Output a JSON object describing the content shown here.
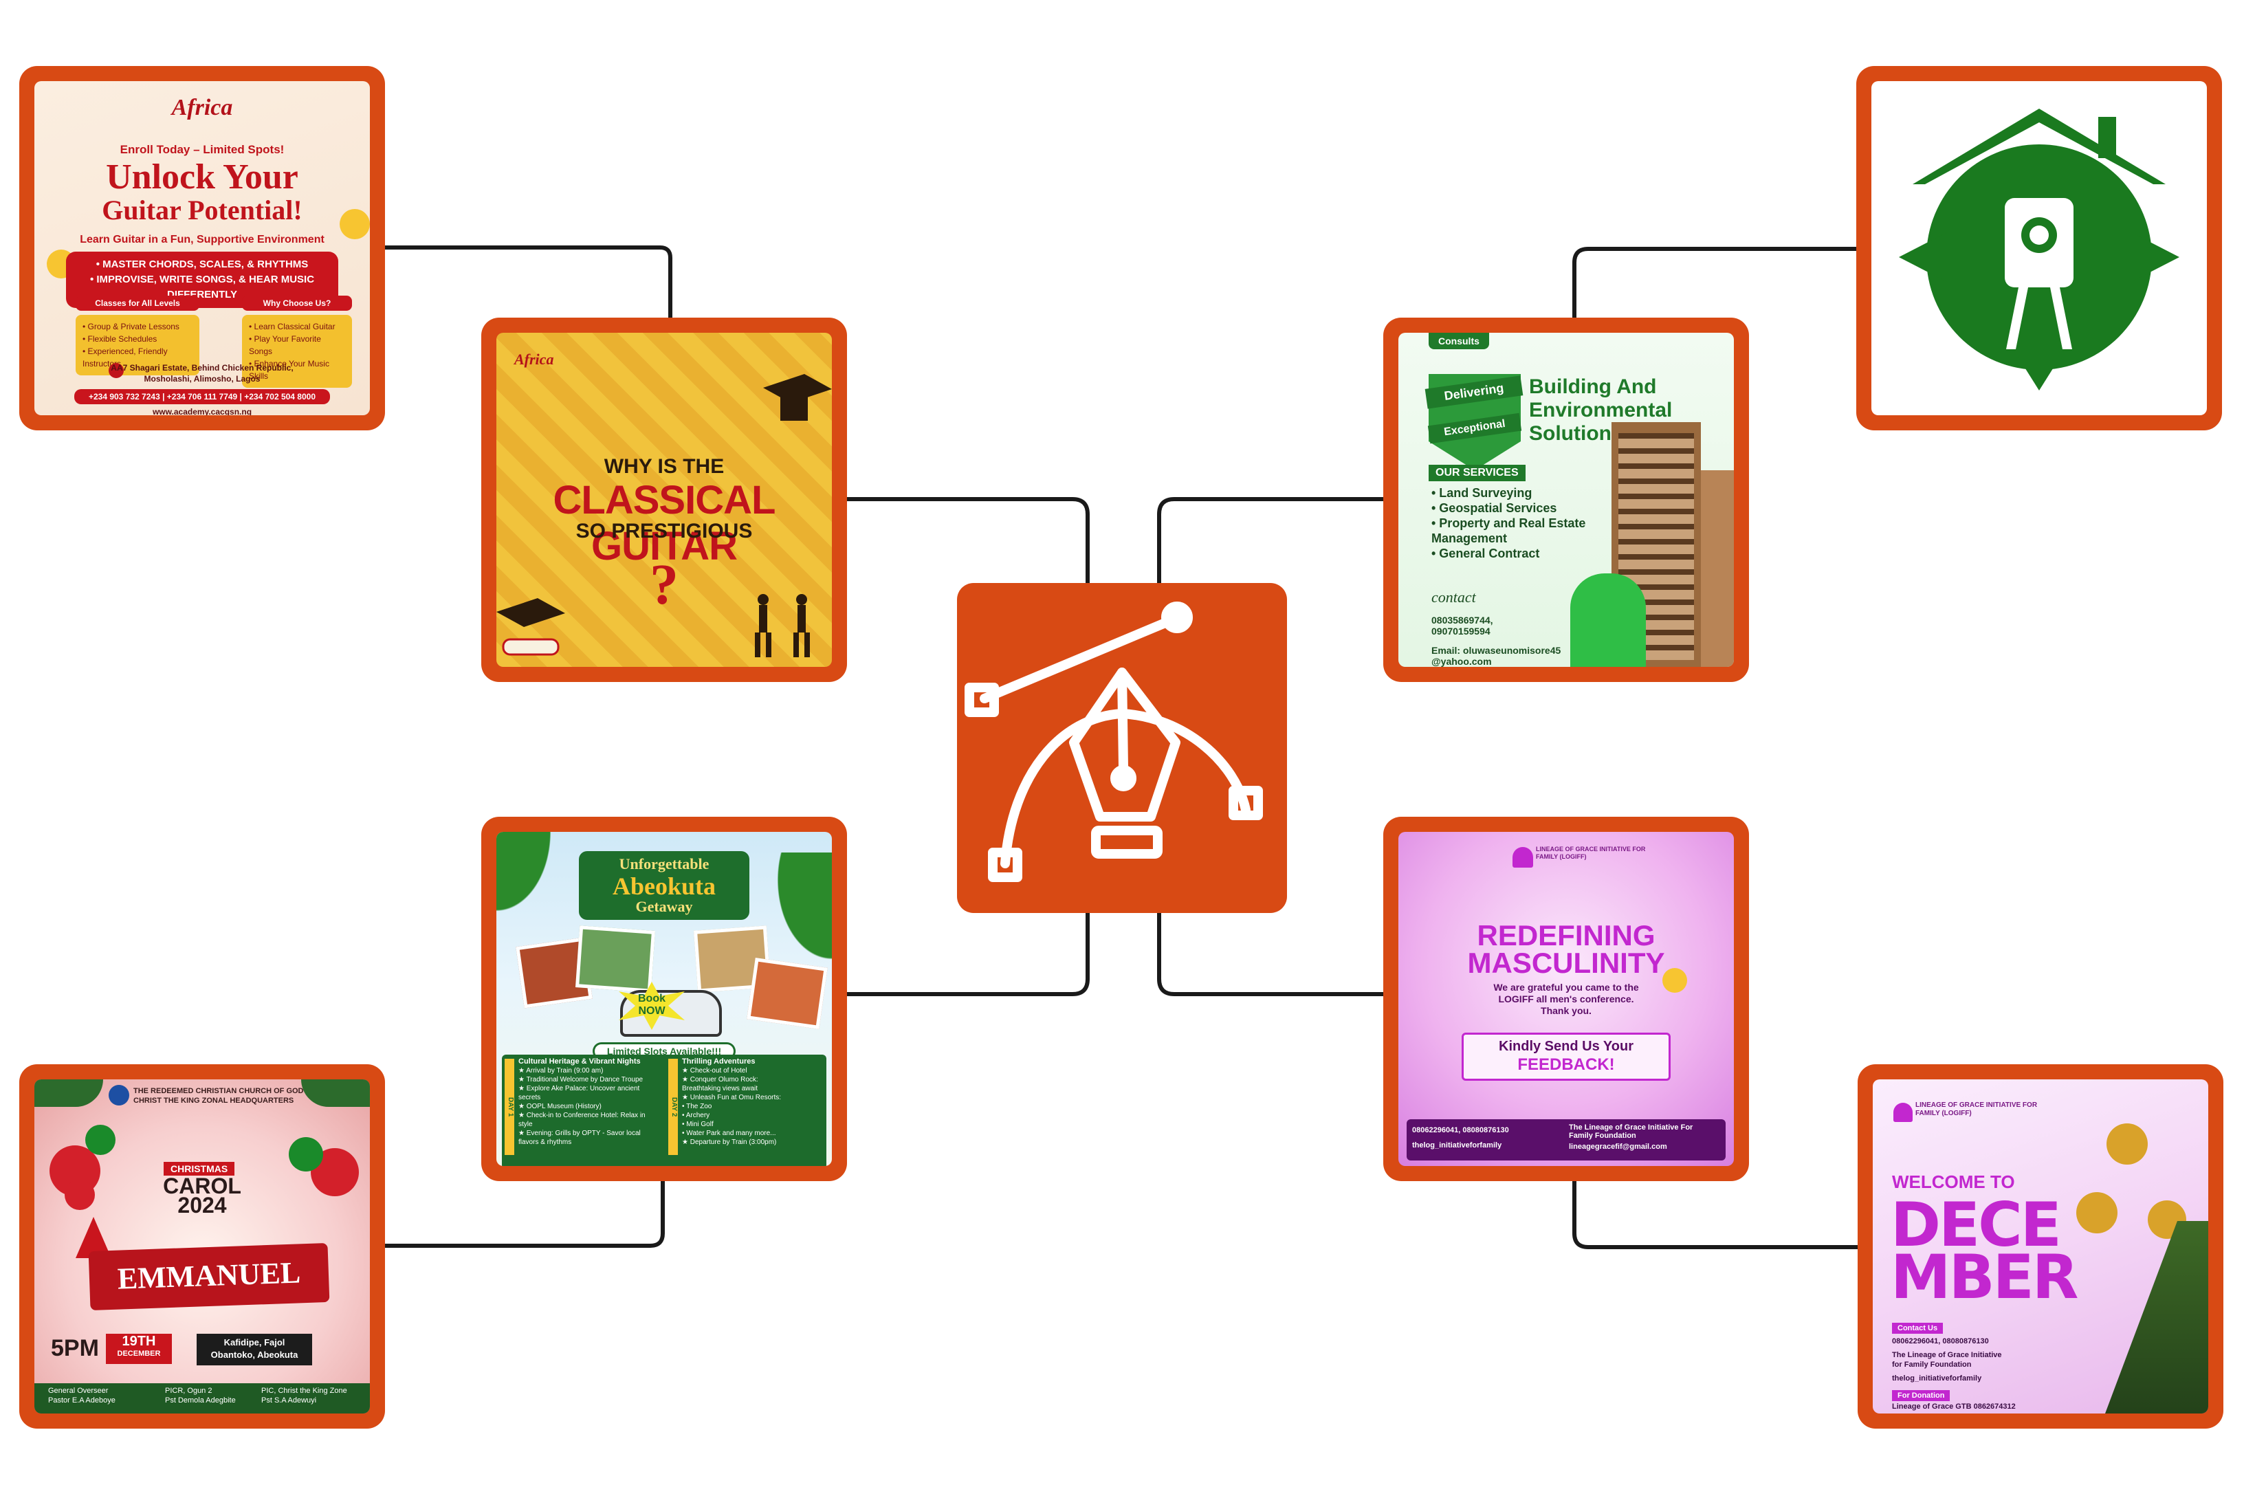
{
  "colors": {
    "accent": "#d84a14",
    "connector": "#1a1a1a",
    "green": "#1a7a1f"
  },
  "hub": {
    "icon": "pen-tool-icon"
  },
  "guitar_flyer": {
    "brand": "Africa",
    "enroll": "Enroll Today – Limited Spots!",
    "headline1": "Unlock Your",
    "headline2": "Guitar Potential!",
    "tagline": "Learn Guitar in a Fun, Supportive Environment",
    "bullet1": "• MASTER CHORDS, SCALES, & RHYTHMS",
    "bullet2": "• IMPROVISE, WRITE SONGS, & HEAR MUSIC DIFFERENTLY",
    "classes_label": "Classes for All Levels",
    "classes_items": [
      "• Group & Private Lessons",
      "• Flexible Schedules",
      "• Experienced, Friendly Instructors"
    ],
    "why_label": "Why Choose Us?",
    "why_items": [
      "• Learn Classical Guitar",
      "• Play Your Favorite Songs",
      "• Enhance Your Music Skills"
    ],
    "address1": "AA7 Shagari Estate, Behind Chicken Republic,",
    "address2": "Mosholashi, Alimosho, Lagos",
    "phones": "+234 903 732 7243 | +234 706 111 7749 | +234 702 504 8000",
    "website": "www.academy.cacgsn.ng"
  },
  "classical_flyer": {
    "brand": "Africa",
    "line1": "WHY IS THE",
    "line2": "CLASSICAL GUITAR",
    "line3": "SO PRESTIGIOUS",
    "question": "?"
  },
  "building_flyer": {
    "company": "Consults",
    "badge1": "Delivering",
    "badge2": "Exceptional",
    "title1": "Building And",
    "title2": "Environmental",
    "title3": "Solutions",
    "services_label": "OUR SERVICES",
    "services": [
      "• Land Surveying",
      "• Geospatial Services",
      "• Property and Real Estate",
      "  Management",
      "• General Contract"
    ],
    "contact_label": "contact",
    "phone1": "08035869744,",
    "phone2": "09070159594",
    "email": "Email: oluwaseunomisore45",
    "email2": "@yahoo.com"
  },
  "abeokuta_flyer": {
    "title1": "Unforgettable",
    "title2": "Abeokuta",
    "title3": "Getaway",
    "book1": "Book",
    "book2": "NOW",
    "limited": "Limited Slots Available!!!",
    "day1_label": "DAY 1",
    "day1_title": "Cultural Heritage & Vibrant Nights",
    "day1_items": [
      "★ Arrival by Train (9:00 am)",
      "★ Traditional Welcome by Dance Troupe",
      "★ Explore Ake Palace: Uncover ancient",
      "secrets",
      "★ OOPL Museum (History)",
      "★ Check-in to Conference Hotel: Relax in",
      "style",
      "★ Evening: Grills by OPTY - Savor local",
      "flavors & rhythms"
    ],
    "day2_label": "DAY 2",
    "day2_title": "Thrilling Adventures",
    "day2_items": [
      "★ Check-out of Hotel",
      "★ Conquer Olumo Rock:",
      "Breathtaking views await",
      "★ Unleash Fun at Omu Resorts:",
      "• The Zoo",
      "• Archery",
      "• Mini Golf",
      "• Water Park and many more...",
      "★ Departure by Train (3:00pm)"
    ]
  },
  "masculinity_flyer": {
    "org": "LINEAGE OF GRACE INITIATIVE FOR FAMILY (LOGIFF)",
    "line1": "REDEFINING",
    "line2": "MASCULINITY",
    "thanks1": "We are grateful you came to the",
    "thanks2": "LOGIFF all men's conference.",
    "thanks3": "Thank you.",
    "cta1": "Kindly Send Us Your",
    "cta2": "FEEDBACK!",
    "phones": "08062296041, 08080876130",
    "handle": "thelog_initiativeforfamily",
    "fb": "The Lineage of Grace Initiative For Family Foundation",
    "email": "lineagegracefif@gmail.com"
  },
  "christmas_flyer": {
    "church1": "THE REDEEMED CHRISTIAN CHURCH OF GOD",
    "church2": "CHRIST THE KING ZONAL HEADQUARTERS",
    "label": "CHRISTMAS",
    "carol": "CAROL",
    "year": "2024",
    "theme": "EMMANUEL",
    "time": "5PM",
    "date": "19TH",
    "month": "DECEMBER",
    "venue1": "Kafidipe, Fajol",
    "venue2": "Obantoko, Abeokuta",
    "sig1": "General Overseer",
    "sig1b": "Pastor E.A Adeboye",
    "sig2": "PICR, Ogun 2",
    "sig2b": "Pst Demola Adegbite",
    "sig3": "PIC, Christ the King Zone",
    "sig3b": "Pst S.A Adewuyi"
  },
  "december_flyer": {
    "org": "LINEAGE OF GRACE INITIATIVE FOR FAMILY (LOGIFF)",
    "welcome": "WELCOME TO",
    "dec1": "DECE",
    "dec2": "MBER",
    "contact_label": "Contact Us",
    "phones": "08062296041, 08080876130",
    "fb1": "The Lineage of Grace Initiative",
    "fb2": "for Family Foundation",
    "handle": "thelog_initiativeforfamily",
    "donation_label": "For Donation",
    "donation": "Lineage of Grace GTB 0862674312"
  },
  "logo_card": {
    "icon": "surveyor-house-logo-icon"
  }
}
